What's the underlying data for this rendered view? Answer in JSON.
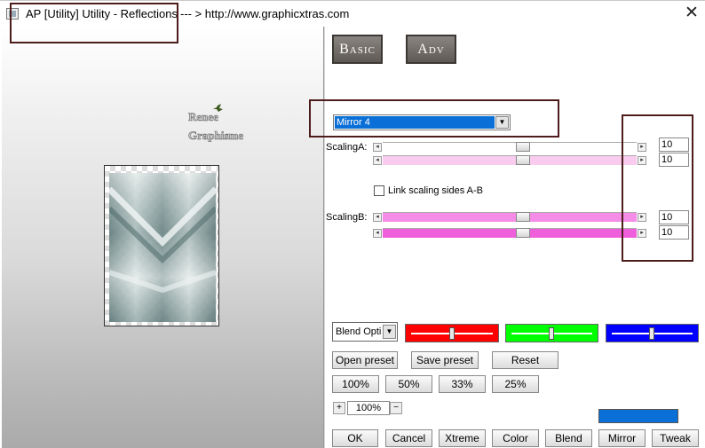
{
  "window": {
    "title": "AP [Utility]  Utility - Reflections",
    "url_text": "--- > http://www.graphicxtras.com",
    "close_glyph": "✕"
  },
  "preview": {
    "watermark_line1": "Renee",
    "watermark_line2": "Graphisme"
  },
  "tabs": [
    {
      "label": "Basic"
    },
    {
      "label": "Adv"
    }
  ],
  "effect": {
    "selected": "Mirror 4"
  },
  "scaling_a": {
    "label": "ScalingA:",
    "rows": [
      {
        "value": "10",
        "level": 0.48
      },
      {
        "value": "10",
        "level": 0.48
      }
    ]
  },
  "link": {
    "label": "Link scaling sides A-B",
    "checked": false
  },
  "scaling_b": {
    "label": "ScalingB:",
    "rows": [
      {
        "value": "10",
        "level": 0.48
      },
      {
        "value": "10",
        "level": 0.48
      }
    ]
  },
  "blend": {
    "label": "Blend Options",
    "display": "Blend Opti"
  },
  "color_sliders": [
    {
      "name": "red",
      "color": "#ff0000",
      "level": 0.5
    },
    {
      "name": "green",
      "color": "#00ff00",
      "level": 0.5
    },
    {
      "name": "blue",
      "color": "#0000ff",
      "level": 0.5
    }
  ],
  "preset_buttons": {
    "open": "Open preset",
    "save": "Save preset",
    "reset": "Reset"
  },
  "zoom_buttons": [
    "100%",
    "50%",
    "33%",
    "25%"
  ],
  "zoom": {
    "plus": "+",
    "value": "100%",
    "minus": "−"
  },
  "preview_color": "#0a6fd6",
  "bottom_buttons": [
    "OK",
    "Cancel",
    "Xtreme",
    "Color",
    "Blend",
    "Mirror",
    "Tweak"
  ],
  "colors": {
    "accent": "#0a6fd6",
    "annotation": "#4f1c1c",
    "scaling_a_track": "#f9cbef",
    "scaling_b_track": "#f58ce8"
  }
}
